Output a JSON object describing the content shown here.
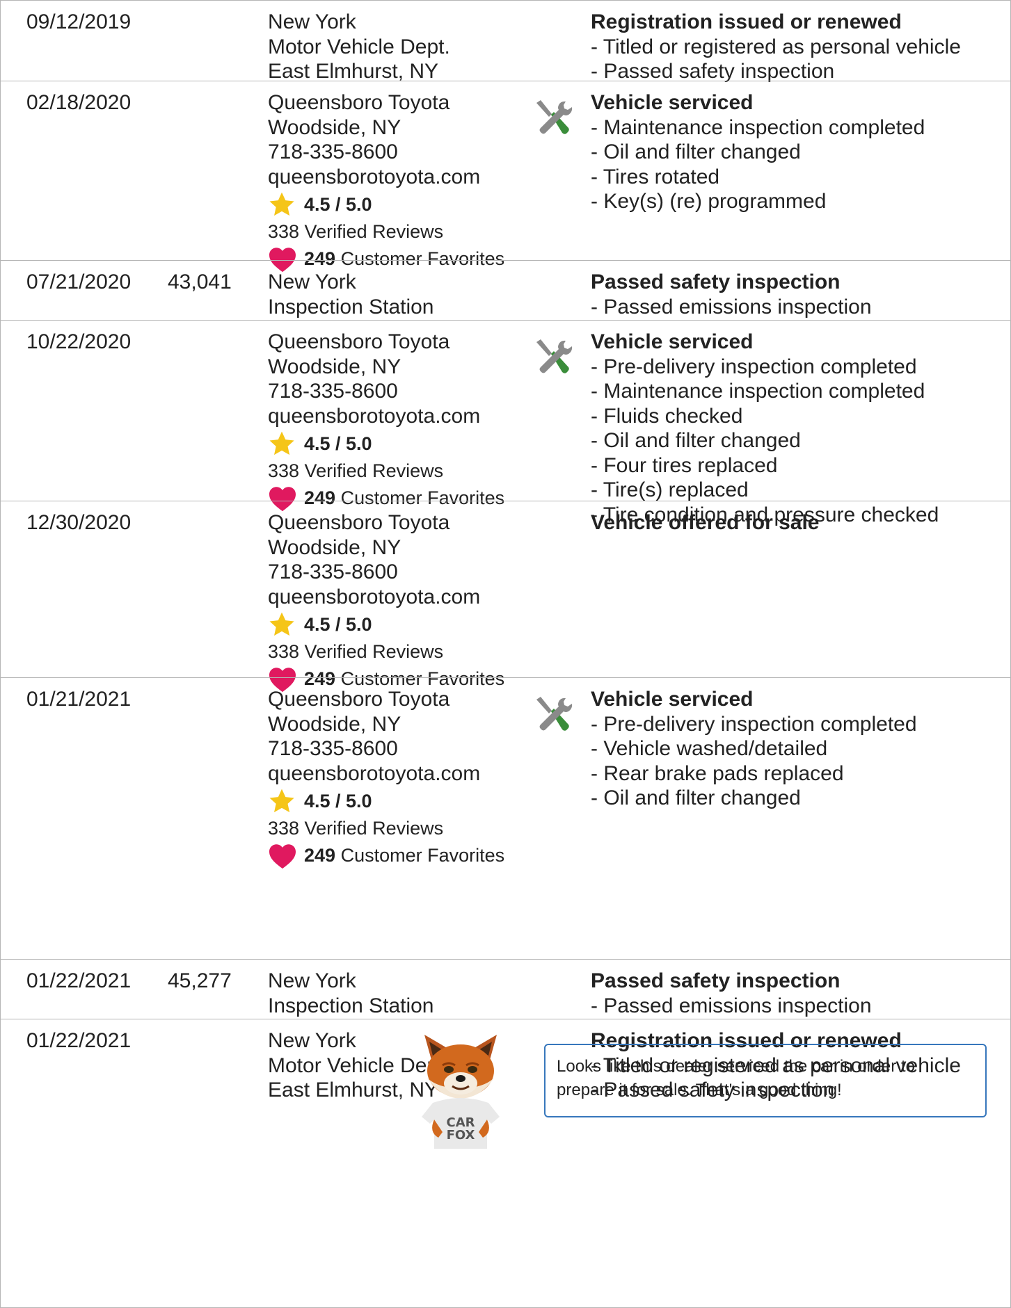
{
  "records": [
    {
      "date": "09/12/2019",
      "odometer": "",
      "source_lines": [
        "New York",
        "Motor Vehicle Dept.",
        "East Elmhurst, NY"
      ],
      "dealer": null,
      "service_icon": false,
      "comment_title": "Registration issued or renewed",
      "comment_items": [
        "- Titled or registered as personal vehicle",
        "- Passed safety inspection"
      ]
    },
    {
      "date": "02/18/2020",
      "odometer": "",
      "source_lines": [
        "Queensboro Toyota",
        "Woodside, NY",
        "718-335-8600",
        "queensborotoyota.com"
      ],
      "dealer": {
        "rating": "4.5 / 5.0",
        "reviews": "338 Verified Reviews",
        "favorites_count": "249",
        "favorites_label": " Customer Favorites"
      },
      "service_icon": true,
      "comment_title": "Vehicle serviced",
      "comment_items": [
        "- Maintenance inspection completed",
        "- Oil and filter changed",
        "- Tires rotated",
        "- Key(s) (re) programmed"
      ]
    },
    {
      "date": "07/21/2020",
      "odometer": "43,041",
      "source_lines": [
        "New York",
        "Inspection Station"
      ],
      "dealer": null,
      "service_icon": false,
      "comment_title": "Passed safety inspection",
      "comment_items": [
        "- Passed emissions inspection"
      ]
    },
    {
      "date": "10/22/2020",
      "odometer": "",
      "source_lines": [
        "Queensboro Toyota",
        "Woodside, NY",
        "718-335-8600",
        "queensborotoyota.com"
      ],
      "dealer": {
        "rating": "4.5 / 5.0",
        "reviews": "338 Verified Reviews",
        "favorites_count": "249",
        "favorites_label": " Customer Favorites"
      },
      "service_icon": true,
      "comment_title": "Vehicle serviced",
      "comment_items": [
        "- Pre-delivery inspection completed",
        "- Maintenance inspection completed",
        "- Fluids checked",
        "- Oil and filter changed",
        "- Four tires replaced",
        "- Tire(s) replaced",
        "- Tire condition and pressure checked"
      ]
    },
    {
      "date": "12/30/2020",
      "odometer": "",
      "source_lines": [
        "Queensboro Toyota",
        "Woodside, NY",
        "718-335-8600",
        "queensborotoyota.com"
      ],
      "dealer": {
        "rating": "4.5 / 5.0",
        "reviews": "338 Verified Reviews",
        "favorites_count": "249",
        "favorites_label": " Customer Favorites"
      },
      "service_icon": false,
      "comment_title": "Vehicle offered for sale",
      "comment_items": []
    },
    {
      "date": "01/21/2021",
      "odometer": "",
      "source_lines": [
        "Queensboro Toyota",
        "Woodside, NY",
        "718-335-8600",
        "queensborotoyota.com"
      ],
      "dealer": {
        "rating": "4.5 / 5.0",
        "reviews": "338 Verified Reviews",
        "favorites_count": "249",
        "favorites_label": " Customer Favorites"
      },
      "service_icon": true,
      "comment_title": "Vehicle serviced",
      "comment_items": [
        "- Pre-delivery inspection completed",
        "- Vehicle washed/detailed",
        "- Rear brake pads replaced",
        "- Oil and filter changed"
      ]
    },
    {
      "date": "01/22/2021",
      "odometer": "45,277",
      "source_lines": [
        "New York",
        "Inspection Station"
      ],
      "dealer": null,
      "service_icon": false,
      "comment_title": "Passed safety inspection",
      "comment_items": [
        "- Passed emissions inspection"
      ]
    },
    {
      "date": "01/22/2021",
      "odometer": "",
      "source_lines": [
        "New York",
        "Motor Vehicle Dept.",
        "East Elmhurst, NY"
      ],
      "dealer": null,
      "service_icon": false,
      "comment_title": "Registration issued or renewed",
      "comment_items": [
        "- Titled or registered as personal vehicle",
        "- Passed safety inspection"
      ]
    }
  ],
  "carfox_tip": "Looks like this dealer serviced the car in order to prepare it for sale. That's a good thing!",
  "fox_shirt_text": [
    "CAR",
    "FOX"
  ],
  "icons": {
    "service": "wrench-screwdriver-icon",
    "rating": "star-icon",
    "favorites": "heart-icon",
    "mascot": "carfox-mascot"
  },
  "colors": {
    "star": "#f5c518",
    "heart": "#e0195f",
    "tool_green": "#3a8d3a",
    "tool_gray": "#8a8a8a",
    "tip_border": "#3777bc",
    "divider": "#b5b5b5"
  }
}
